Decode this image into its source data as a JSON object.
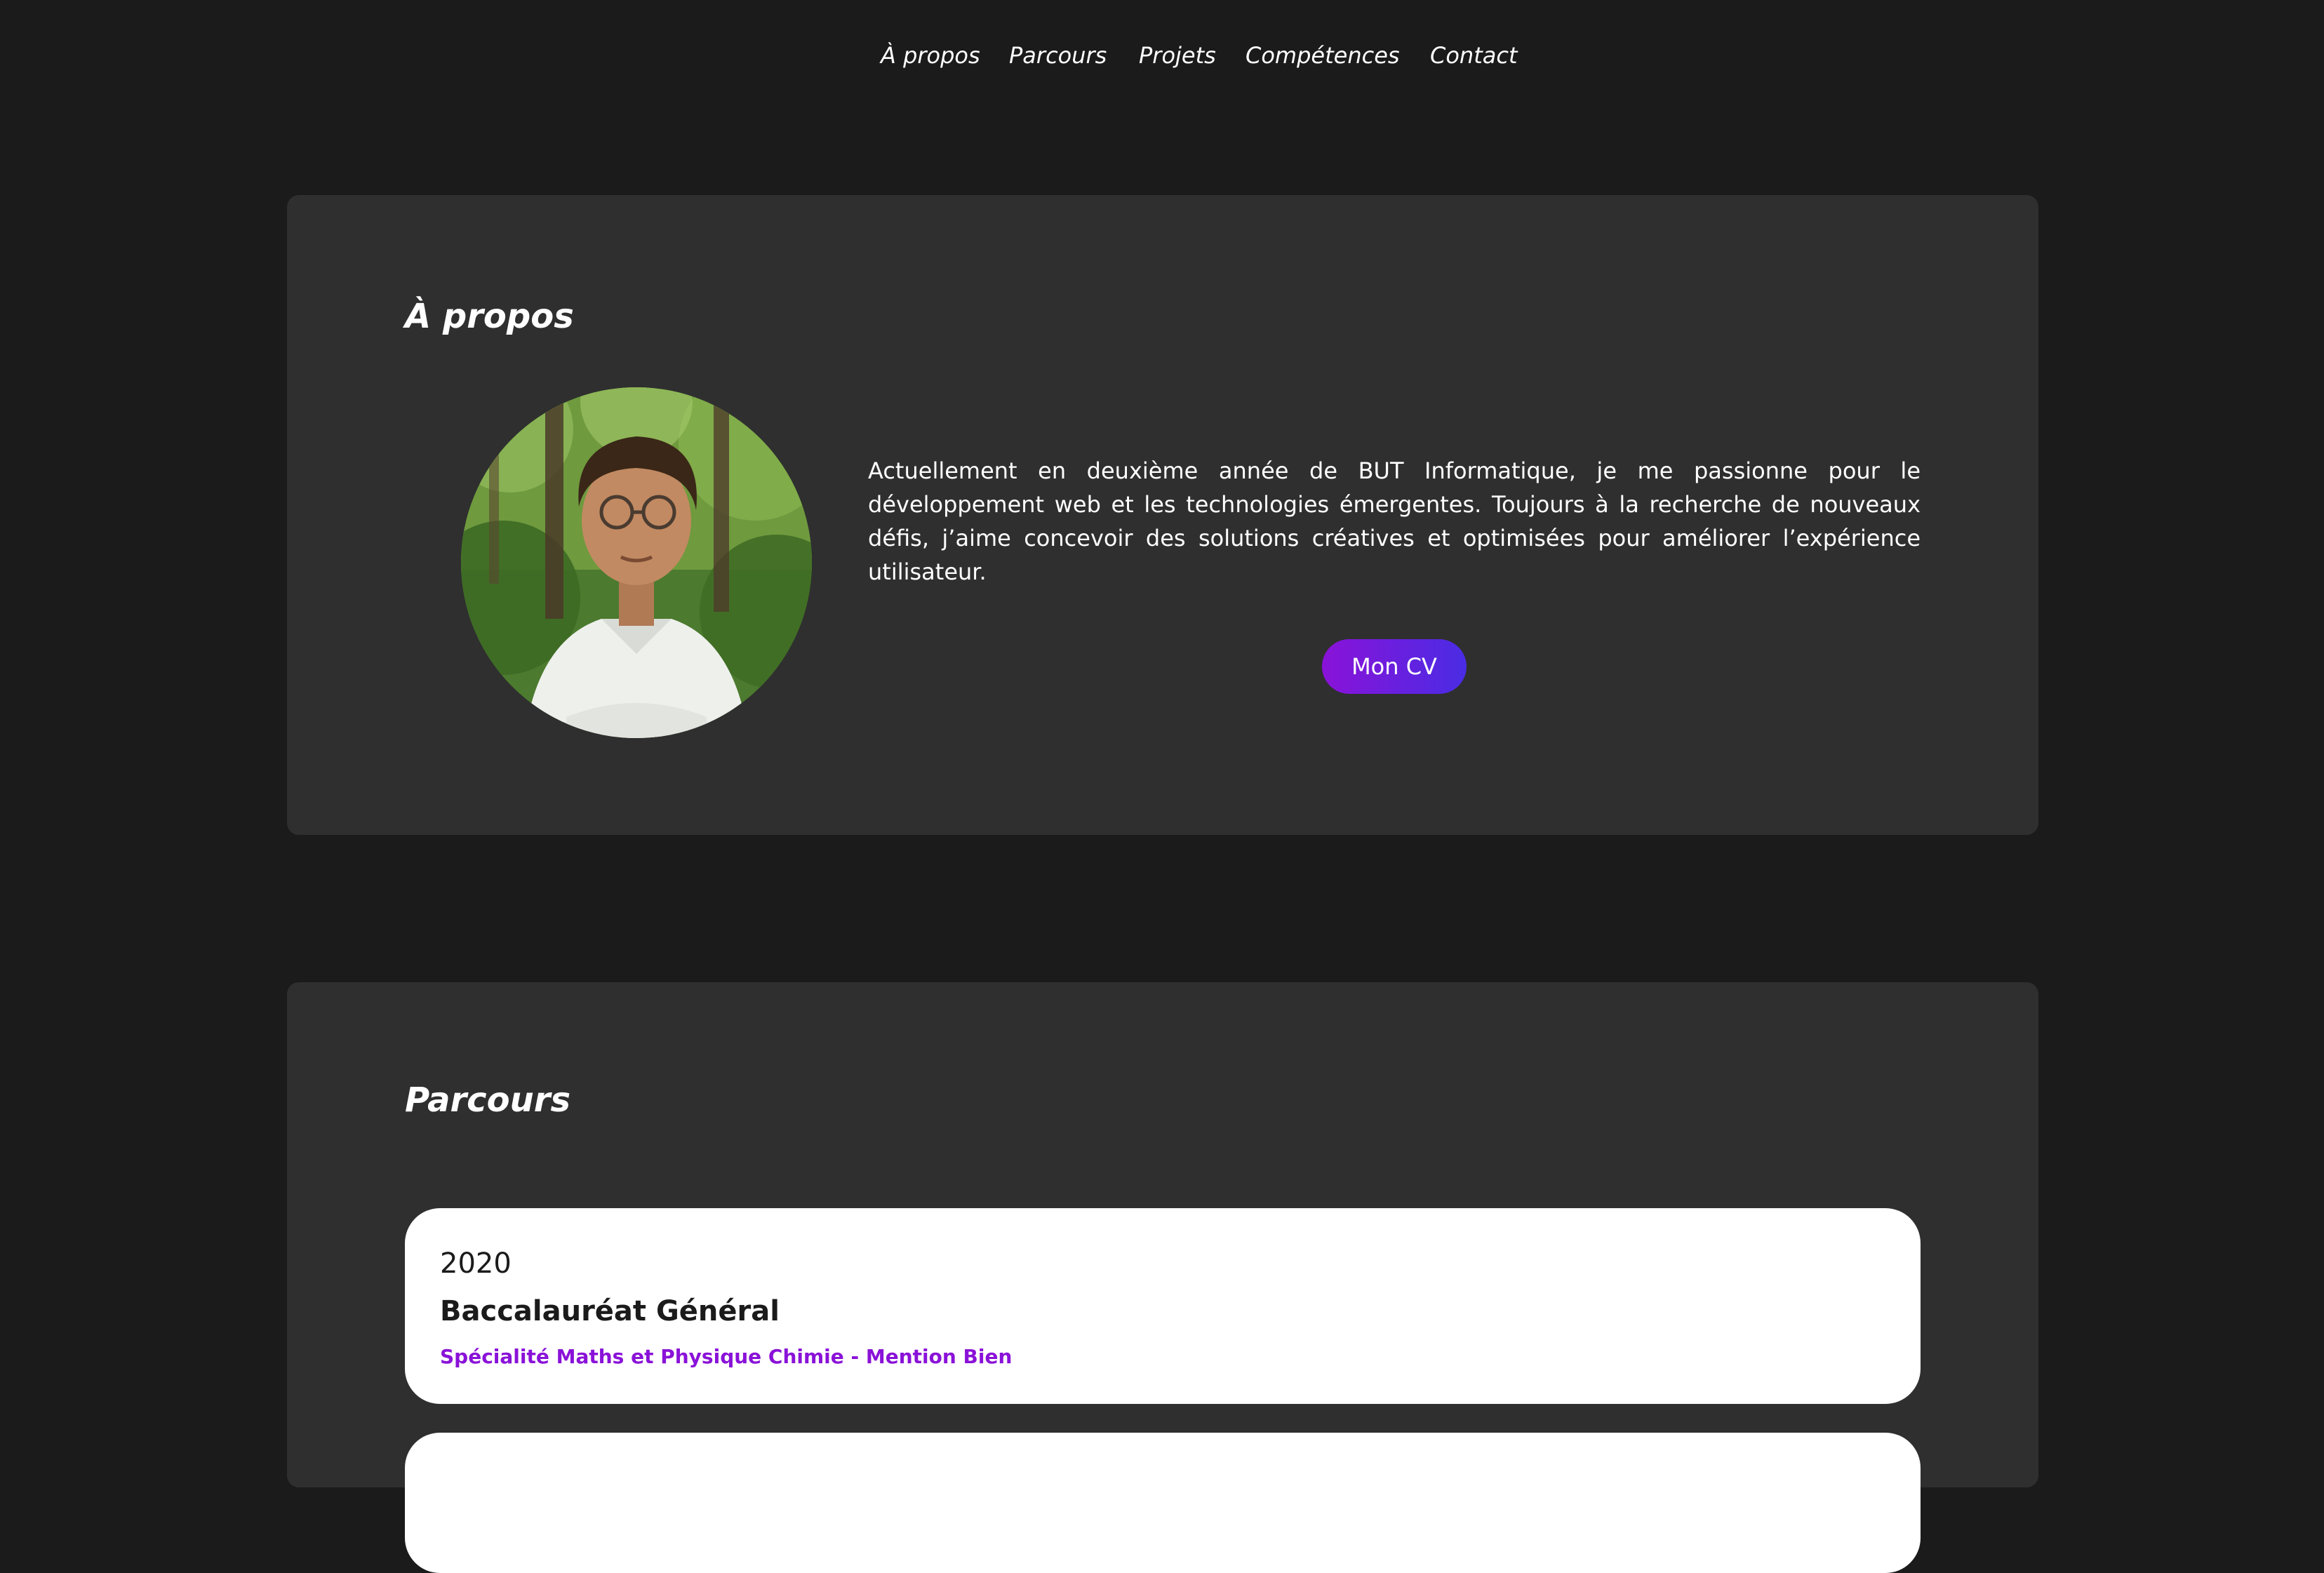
{
  "nav": {
    "items": [
      {
        "label": "À propos"
      },
      {
        "label": "Parcours"
      },
      {
        "label": "Projets"
      },
      {
        "label": "Compétences"
      },
      {
        "label": "Contact"
      }
    ]
  },
  "about": {
    "title": "À propos",
    "bio": "Actuellement en deuxième année de BUT Informatique, je me passionne pour le développement web et les technologies émergentes. Toujours à la recherche de nouveaux défis, j’aime concevoir des solutions créatives et optimisées pour améliorer l’expérience utilisateur.",
    "cv_button_label": "Mon CV"
  },
  "parcours": {
    "title": "Parcours",
    "entries": [
      {
        "year": "2020",
        "degree": "Baccalauréat Général",
        "detail": "Spécialité Maths et Physique Chimie - Mention Bien"
      }
    ]
  },
  "colors": {
    "background": "#1b1b1b",
    "card": "#2f2f2f",
    "accent": "#8a12d8",
    "accent_gradient_end": "#4a2ce4",
    "timeline_card": "#ffffff"
  }
}
